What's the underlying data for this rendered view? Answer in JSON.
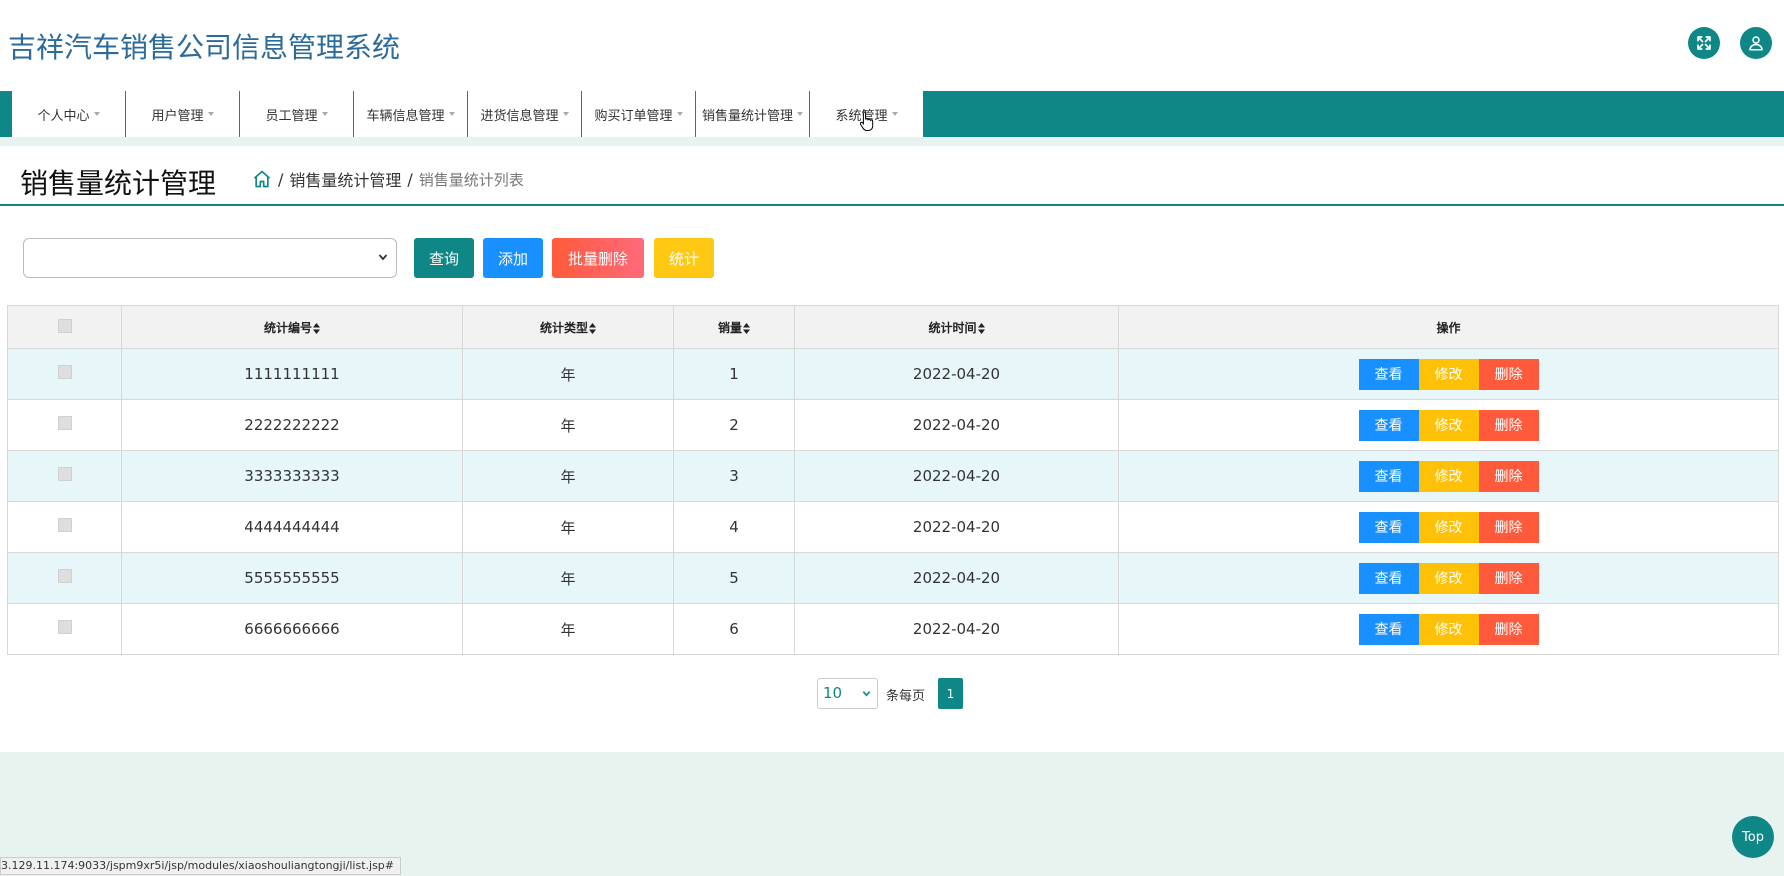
{
  "header": {
    "title": "吉祥汽车销售公司信息管理系统",
    "fullscreen_icon": "expand-icon",
    "user_icon": "user-icon"
  },
  "nav": {
    "items": [
      {
        "label": "个人中心"
      },
      {
        "label": "用户管理"
      },
      {
        "label": "员工管理"
      },
      {
        "label": "车辆信息管理"
      },
      {
        "label": "进货信息管理"
      },
      {
        "label": "购买订单管理"
      },
      {
        "label": "销售量统计管理"
      },
      {
        "label": "系统管理"
      }
    ]
  },
  "page": {
    "title": "销售量统计管理",
    "breadcrumb": {
      "sep": "/",
      "level1": "销售量统计管理",
      "level2": "销售量统计列表"
    }
  },
  "toolbar": {
    "query": "查询",
    "add": "添加",
    "batch_delete": "批量删除",
    "stats": "统计"
  },
  "table": {
    "headers": [
      "统计编号",
      "统计类型",
      "销量",
      "统计时间",
      "操作"
    ],
    "rows": [
      {
        "id": "1111111111",
        "type": "年",
        "qty": "1",
        "time": "2022-04-20"
      },
      {
        "id": "2222222222",
        "type": "年",
        "qty": "2",
        "time": "2022-04-20"
      },
      {
        "id": "3333333333",
        "type": "年",
        "qty": "3",
        "time": "2022-04-20"
      },
      {
        "id": "4444444444",
        "type": "年",
        "qty": "4",
        "time": "2022-04-20"
      },
      {
        "id": "5555555555",
        "type": "年",
        "qty": "5",
        "time": "2022-04-20"
      },
      {
        "id": "6666666666",
        "type": "年",
        "qty": "6",
        "time": "2022-04-20"
      }
    ],
    "actions": {
      "view": "查看",
      "edit": "修改",
      "delete": "删除"
    }
  },
  "pager": {
    "page_size": "10",
    "per_page_label": "条每页",
    "current_page": "1"
  },
  "top_button": "Top",
  "status_url": "3.129.11.174:9033/jspm9xr5i/jsp/modules/xiaoshouliangtongji/list.jsp#",
  "colors": {
    "primary": "#0f8787",
    "blue": "#1890ff",
    "yellow": "#ffc107",
    "red": "#ff5a3c",
    "title_blue": "#2a6b9c"
  }
}
